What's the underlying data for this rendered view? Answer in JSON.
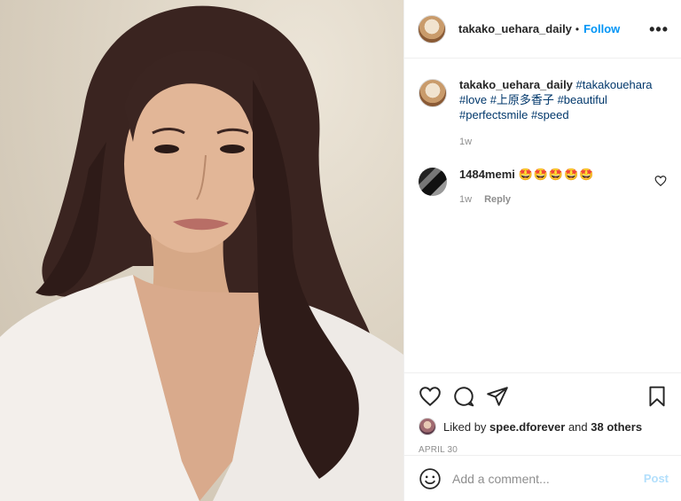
{
  "photo": {
    "alt_icon": "portrait-photo"
  },
  "header": {
    "username": "takako_uehara_daily",
    "separator": "•",
    "follow_label": "Follow",
    "more_icon": "ellipsis-icon",
    "more_label": "•••"
  },
  "caption": {
    "username": "takako_uehara_daily",
    "tags": [
      "#takakouehara",
      "#love",
      "#上原多香子",
      "#beautiful",
      "#perfectsmile",
      "#speed"
    ],
    "time": "1w"
  },
  "comments": [
    {
      "username": "1484memi",
      "text": "🤩🤩🤩🤩🤩",
      "time": "1w",
      "reply_label": "Reply"
    }
  ],
  "actions": {
    "like_icon": "heart-icon",
    "comment_icon": "speech-bubble-icon",
    "share_icon": "paper-plane-icon",
    "save_icon": "bookmark-icon"
  },
  "likes": {
    "prefix": "Liked by",
    "user": "spee.dforever",
    "middle": "and",
    "others": "38 others"
  },
  "date": "April 30",
  "add_comment": {
    "placeholder": "Add a comment...",
    "post_label": "Post",
    "emoji_icon": "smiley-icon"
  },
  "colors": {
    "link_blue": "#0095f6",
    "tag_blue": "#00376b",
    "muted": "#8e8e8e",
    "post_disabled": "#b2dffc"
  }
}
